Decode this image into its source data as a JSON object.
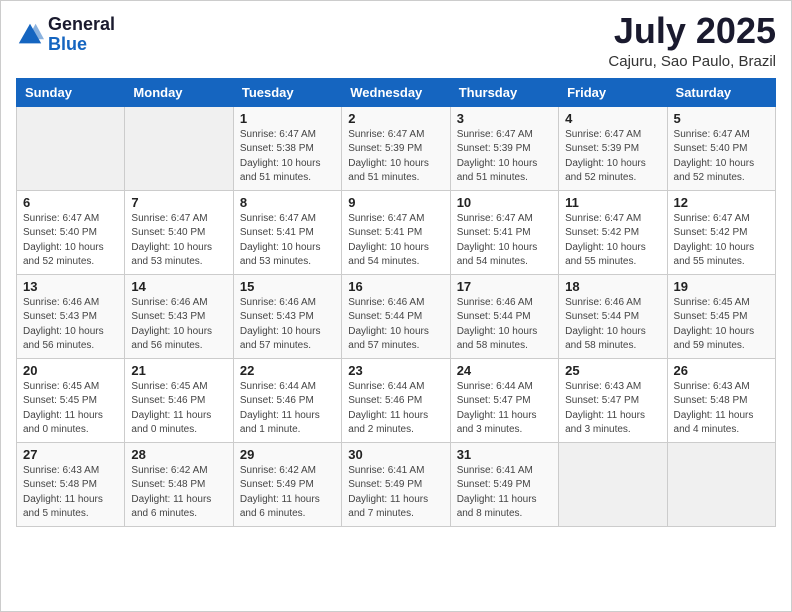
{
  "header": {
    "logo_general": "General",
    "logo_blue": "Blue",
    "month_title": "July 2025",
    "location": "Cajuru, Sao Paulo, Brazil"
  },
  "days_of_week": [
    "Sunday",
    "Monday",
    "Tuesday",
    "Wednesday",
    "Thursday",
    "Friday",
    "Saturday"
  ],
  "weeks": [
    [
      {
        "day": "",
        "info": ""
      },
      {
        "day": "",
        "info": ""
      },
      {
        "day": "1",
        "info": "Sunrise: 6:47 AM\nSunset: 5:38 PM\nDaylight: 10 hours and 51 minutes."
      },
      {
        "day": "2",
        "info": "Sunrise: 6:47 AM\nSunset: 5:39 PM\nDaylight: 10 hours and 51 minutes."
      },
      {
        "day": "3",
        "info": "Sunrise: 6:47 AM\nSunset: 5:39 PM\nDaylight: 10 hours and 51 minutes."
      },
      {
        "day": "4",
        "info": "Sunrise: 6:47 AM\nSunset: 5:39 PM\nDaylight: 10 hours and 52 minutes."
      },
      {
        "day": "5",
        "info": "Sunrise: 6:47 AM\nSunset: 5:40 PM\nDaylight: 10 hours and 52 minutes."
      }
    ],
    [
      {
        "day": "6",
        "info": "Sunrise: 6:47 AM\nSunset: 5:40 PM\nDaylight: 10 hours and 52 minutes."
      },
      {
        "day": "7",
        "info": "Sunrise: 6:47 AM\nSunset: 5:40 PM\nDaylight: 10 hours and 53 minutes."
      },
      {
        "day": "8",
        "info": "Sunrise: 6:47 AM\nSunset: 5:41 PM\nDaylight: 10 hours and 53 minutes."
      },
      {
        "day": "9",
        "info": "Sunrise: 6:47 AM\nSunset: 5:41 PM\nDaylight: 10 hours and 54 minutes."
      },
      {
        "day": "10",
        "info": "Sunrise: 6:47 AM\nSunset: 5:41 PM\nDaylight: 10 hours and 54 minutes."
      },
      {
        "day": "11",
        "info": "Sunrise: 6:47 AM\nSunset: 5:42 PM\nDaylight: 10 hours and 55 minutes."
      },
      {
        "day": "12",
        "info": "Sunrise: 6:47 AM\nSunset: 5:42 PM\nDaylight: 10 hours and 55 minutes."
      }
    ],
    [
      {
        "day": "13",
        "info": "Sunrise: 6:46 AM\nSunset: 5:43 PM\nDaylight: 10 hours and 56 minutes."
      },
      {
        "day": "14",
        "info": "Sunrise: 6:46 AM\nSunset: 5:43 PM\nDaylight: 10 hours and 56 minutes."
      },
      {
        "day": "15",
        "info": "Sunrise: 6:46 AM\nSunset: 5:43 PM\nDaylight: 10 hours and 57 minutes."
      },
      {
        "day": "16",
        "info": "Sunrise: 6:46 AM\nSunset: 5:44 PM\nDaylight: 10 hours and 57 minutes."
      },
      {
        "day": "17",
        "info": "Sunrise: 6:46 AM\nSunset: 5:44 PM\nDaylight: 10 hours and 58 minutes."
      },
      {
        "day": "18",
        "info": "Sunrise: 6:46 AM\nSunset: 5:44 PM\nDaylight: 10 hours and 58 minutes."
      },
      {
        "day": "19",
        "info": "Sunrise: 6:45 AM\nSunset: 5:45 PM\nDaylight: 10 hours and 59 minutes."
      }
    ],
    [
      {
        "day": "20",
        "info": "Sunrise: 6:45 AM\nSunset: 5:45 PM\nDaylight: 11 hours and 0 minutes."
      },
      {
        "day": "21",
        "info": "Sunrise: 6:45 AM\nSunset: 5:46 PM\nDaylight: 11 hours and 0 minutes."
      },
      {
        "day": "22",
        "info": "Sunrise: 6:44 AM\nSunset: 5:46 PM\nDaylight: 11 hours and 1 minute."
      },
      {
        "day": "23",
        "info": "Sunrise: 6:44 AM\nSunset: 5:46 PM\nDaylight: 11 hours and 2 minutes."
      },
      {
        "day": "24",
        "info": "Sunrise: 6:44 AM\nSunset: 5:47 PM\nDaylight: 11 hours and 3 minutes."
      },
      {
        "day": "25",
        "info": "Sunrise: 6:43 AM\nSunset: 5:47 PM\nDaylight: 11 hours and 3 minutes."
      },
      {
        "day": "26",
        "info": "Sunrise: 6:43 AM\nSunset: 5:48 PM\nDaylight: 11 hours and 4 minutes."
      }
    ],
    [
      {
        "day": "27",
        "info": "Sunrise: 6:43 AM\nSunset: 5:48 PM\nDaylight: 11 hours and 5 minutes."
      },
      {
        "day": "28",
        "info": "Sunrise: 6:42 AM\nSunset: 5:48 PM\nDaylight: 11 hours and 6 minutes."
      },
      {
        "day": "29",
        "info": "Sunrise: 6:42 AM\nSunset: 5:49 PM\nDaylight: 11 hours and 6 minutes."
      },
      {
        "day": "30",
        "info": "Sunrise: 6:41 AM\nSunset: 5:49 PM\nDaylight: 11 hours and 7 minutes."
      },
      {
        "day": "31",
        "info": "Sunrise: 6:41 AM\nSunset: 5:49 PM\nDaylight: 11 hours and 8 minutes."
      },
      {
        "day": "",
        "info": ""
      },
      {
        "day": "",
        "info": ""
      }
    ]
  ]
}
